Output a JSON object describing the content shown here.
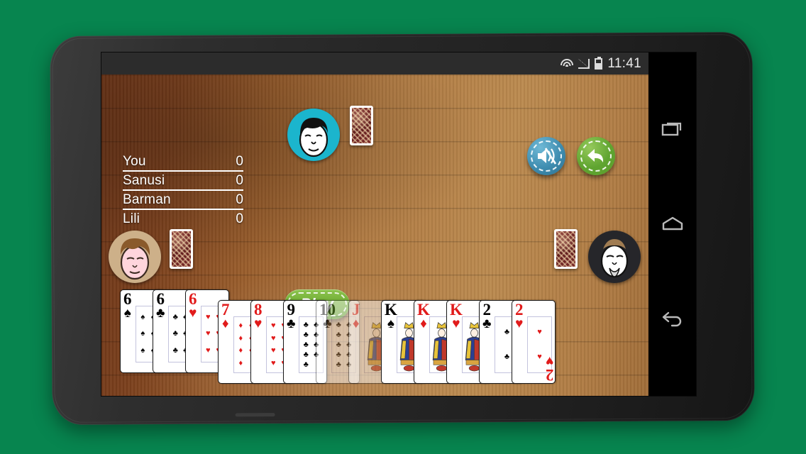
{
  "background_color": "#07854f",
  "device": {
    "name": "android-phone",
    "body_color": "#2a2a2a"
  },
  "statusbar": {
    "time": "11:41",
    "icons": [
      "wifi-icon",
      "signal-icon",
      "battery-icon"
    ]
  },
  "game": {
    "title": "card-game-table",
    "scoreboard": [
      {
        "name": "You",
        "score": "0"
      },
      {
        "name": "Sanusi",
        "score": "0"
      },
      {
        "name": "Barman",
        "score": "0"
      },
      {
        "name": "Lili",
        "score": "0"
      }
    ],
    "play_button": {
      "label": "Play"
    },
    "buttons": [
      {
        "name": "sound-toggle-button",
        "icon": "speaker-mute-icon",
        "color": "#3f8db0"
      },
      {
        "name": "back-button",
        "icon": "back-arrow-icon",
        "color": "#63a832"
      }
    ],
    "avatars": [
      {
        "name": "avatar-top",
        "bg": "#1bb5cd"
      },
      {
        "name": "avatar-left",
        "bg": "#cdb089"
      },
      {
        "name": "avatar-right",
        "bg": "#26262a"
      }
    ],
    "card_backs": 3,
    "hand": [
      {
        "rank": "6",
        "suit": "spades",
        "color": "black",
        "raised": true,
        "faded": false
      },
      {
        "rank": "6",
        "suit": "clubs",
        "color": "black",
        "raised": true,
        "faded": false
      },
      {
        "rank": "6",
        "suit": "hearts",
        "color": "red",
        "raised": true,
        "faded": false
      },
      {
        "rank": "7",
        "suit": "diamonds",
        "color": "red",
        "raised": false,
        "faded": false
      },
      {
        "rank": "8",
        "suit": "hearts",
        "color": "red",
        "raised": false,
        "faded": false
      },
      {
        "rank": "9",
        "suit": "clubs",
        "color": "black",
        "raised": false,
        "faded": false
      },
      {
        "rank": "10",
        "suit": "clubs",
        "color": "black",
        "raised": false,
        "faded": true
      },
      {
        "rank": "J",
        "suit": "diamonds",
        "color": "red",
        "raised": false,
        "faded": true
      },
      {
        "rank": "K",
        "suit": "spades",
        "color": "black",
        "raised": false,
        "faded": false
      },
      {
        "rank": "K",
        "suit": "diamonds",
        "color": "red",
        "raised": false,
        "faded": false
      },
      {
        "rank": "K",
        "suit": "hearts",
        "color": "red",
        "raised": false,
        "faded": false
      },
      {
        "rank": "2",
        "suit": "clubs",
        "color": "black",
        "raised": false,
        "faded": false
      },
      {
        "rank": "2",
        "suit": "hearts",
        "color": "red",
        "raised": false,
        "faded": false
      }
    ]
  },
  "navbar": {
    "items": [
      {
        "name": "recents-button",
        "icon": "recents-icon"
      },
      {
        "name": "home-button",
        "icon": "home-icon"
      },
      {
        "name": "back-nav-button",
        "icon": "back-nav-icon"
      }
    ]
  }
}
